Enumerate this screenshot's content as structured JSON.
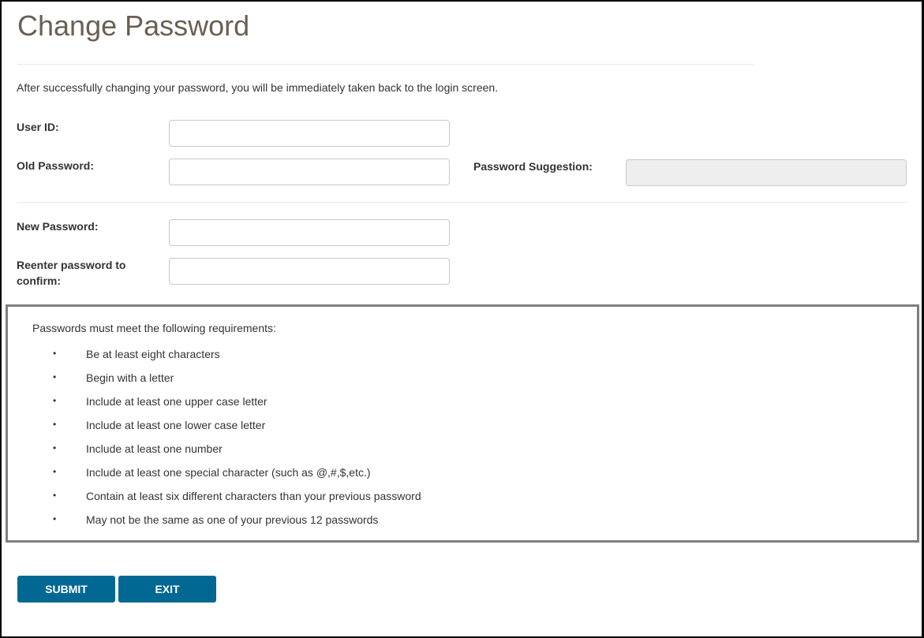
{
  "page": {
    "title": "Change Password",
    "intro": "After successfully changing your password, you will be immediately taken back to the login screen."
  },
  "form": {
    "user_id": {
      "label": "User ID:",
      "value": "",
      "placeholder": ""
    },
    "old_password": {
      "label": "Old Password:",
      "value": "",
      "placeholder": ""
    },
    "password_suggestion": {
      "label": "Password Suggestion:",
      "value": ""
    },
    "new_password": {
      "label": "New Password:",
      "value": "",
      "placeholder": ""
    },
    "confirm_password": {
      "label_line1": "Reenter password to",
      "label_line2": "confirm:",
      "value": "",
      "placeholder": ""
    }
  },
  "requirements": {
    "heading": "Passwords must meet the following requirements:",
    "bullet": "•",
    "items": [
      "Be at least eight characters",
      "Begin with a letter",
      "Include at least one upper case letter",
      "Include at least one lower case letter",
      "Include at least one number",
      "Include at least one special character (such as @,#,$,etc.)",
      "Contain at least six different characters than your previous password",
      "May not be the same as one of your previous 12 passwords"
    ]
  },
  "buttons": {
    "submit": "SUBMIT",
    "exit": "EXIT"
  },
  "colors": {
    "title": "#6b5f54",
    "button": "#006892",
    "readonly_field": "#eeeeee",
    "box_border": "#7f7f7f"
  }
}
